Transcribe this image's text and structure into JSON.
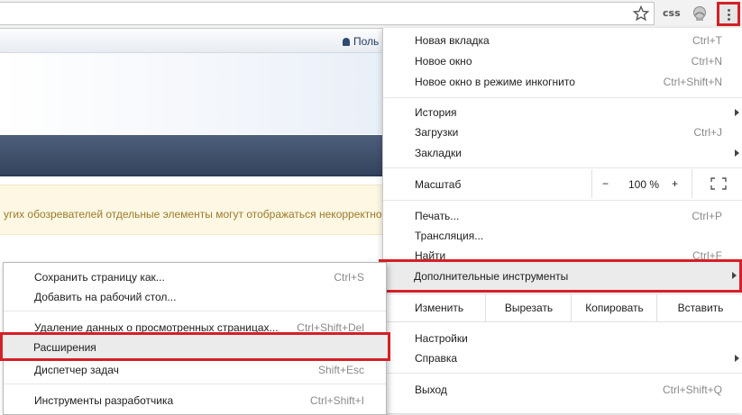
{
  "toolbar": {
    "css_ext_label": "css",
    "icons": {
      "bookmark": "star-icon",
      "extension": "stamp-icon",
      "menu": "kebab-menu-icon"
    }
  },
  "page": {
    "user_link": "Поль",
    "notice": "угих обозревателей отдельные элементы могут отображаться некорректно"
  },
  "menu": {
    "new_tab": {
      "label": "Новая вкладка",
      "shortcut": "Ctrl+T"
    },
    "new_window": {
      "label": "Новое окно",
      "shortcut": "Ctrl+N"
    },
    "incognito": {
      "label": "Новое окно в режиме инкогнито",
      "shortcut": "Ctrl+Shift+N"
    },
    "history": {
      "label": "История"
    },
    "downloads": {
      "label": "Загрузки",
      "shortcut": "Ctrl+J"
    },
    "bookmarks": {
      "label": "Закладки"
    },
    "zoom": {
      "label": "Масштаб",
      "minus": "−",
      "value": "100 %",
      "plus": "+"
    },
    "print": {
      "label": "Печать...",
      "shortcut": "Ctrl+P"
    },
    "cast": {
      "label": "Трансляция..."
    },
    "find": {
      "label": "Найти",
      "shortcut": "Ctrl+F"
    },
    "more_tools": {
      "label": "Дополнительные инструменты"
    },
    "edit": {
      "label": "Изменить",
      "cut": "Вырезать",
      "copy": "Копировать",
      "paste": "Вставить"
    },
    "settings": {
      "label": "Настройки"
    },
    "help": {
      "label": "Справка"
    },
    "exit": {
      "label": "Выход",
      "shortcut": "Ctrl+Shift+Q"
    }
  },
  "submenu": {
    "save_page": {
      "label": "Сохранить страницу как...",
      "shortcut": "Ctrl+S"
    },
    "add_desktop": {
      "label": "Добавить на рабочий стол..."
    },
    "clear_data": {
      "label": "Удаление данных о просмотренных страницах...",
      "shortcut": "Ctrl+Shift+Del"
    },
    "extensions": {
      "label": "Расширения"
    },
    "task_manager": {
      "label": "Диспетчер задач",
      "shortcut": "Shift+Esc"
    },
    "devtools": {
      "label": "Инструменты разработчика",
      "shortcut": "Ctrl+Shift+I"
    }
  },
  "colors": {
    "highlight": "#d61f26",
    "hover": "#ebebeb",
    "notice_text": "#9c7a2a",
    "dark_bar": "#3c4b66"
  }
}
